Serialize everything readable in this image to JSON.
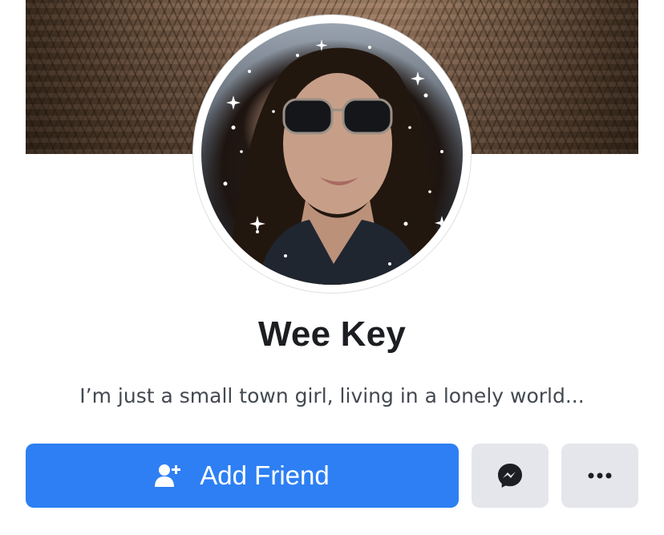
{
  "profile": {
    "name": "Wee Key",
    "bio": "I’m just a small town girl, living in a lonely world..."
  },
  "actions": {
    "add_friend_label": "Add Friend",
    "add_friend_icon": "add-person-icon",
    "messenger_icon": "messenger-icon",
    "more_icon": "more-options-icon"
  },
  "colors": {
    "primary": "#2d7ff3",
    "secondary_button": "#e4e6eb",
    "name_text": "#1c1e21",
    "bio_text": "#444950"
  }
}
